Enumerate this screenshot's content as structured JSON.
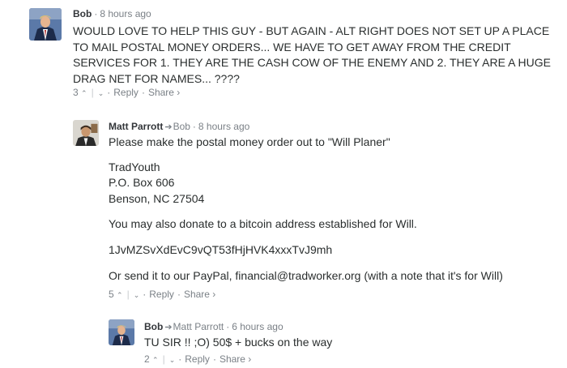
{
  "comments": [
    {
      "author": "Bob",
      "time": "8 hours ago",
      "reply_to": "",
      "lines": [
        "WOULD LOVE TO HELP THIS GUY - BUT AGAIN - ALT RIGHT DOES NOT SET UP A PLACE",
        "TO MAIL POSTAL MONEY ORDERS... WE HAVE TO GET AWAY FROM THE CREDIT",
        "SERVICES FOR 1. THEY ARE THE CASH COW OF THE ENEMY AND 2. THEY ARE A HUGE",
        "DRAG NET FOR NAMES... ????"
      ],
      "votes": "3",
      "reply_label": "Reply",
      "share_label": "Share ›"
    },
    {
      "author": "Matt Parrott",
      "time": "8 hours ago",
      "reply_to": "Bob",
      "paragraphs": [
        "Please make the postal money order out to \"Will Planer\"",
        "TradYouth",
        "P.O. Box 606",
        "Benson, NC 27504",
        "You may also donate to a bitcoin address established for Will.",
        "1JvMZSvXdEvC9vQT53fHjHVK4xxxTvJ9mh",
        "Or send it to our PayPal, financial@tradworker.org (with a note that it's for Will)"
      ],
      "votes": "5",
      "reply_label": "Reply",
      "share_label": "Share ›"
    },
    {
      "author": "Bob",
      "time": "6 hours ago",
      "reply_to": "Matt Parrott",
      "lines": [
        "TU SIR !! ;O) 50$ + bucks on the way"
      ],
      "votes": "2",
      "reply_label": "Reply",
      "share_label": "Share ›"
    }
  ],
  "icons": {
    "upvote": "chevron-up-icon",
    "downvote": "chevron-down-icon",
    "reply_arrow": "reply-arrow-icon"
  },
  "colors": {
    "meta": "#7b8187",
    "author": "#33363a",
    "text": "#2a2e2e"
  }
}
